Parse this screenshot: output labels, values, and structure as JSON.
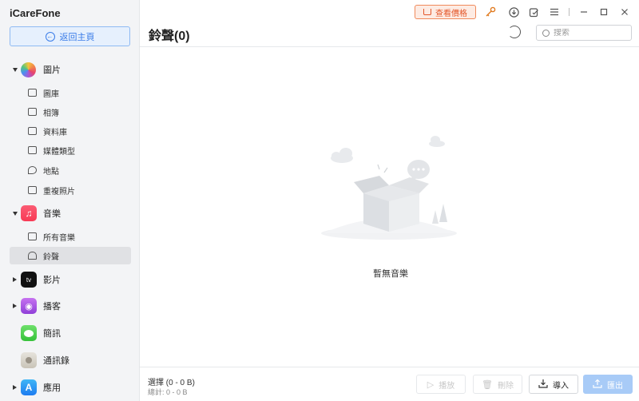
{
  "app": {
    "title": "iCareFone"
  },
  "sidebar": {
    "back_label": "返回主頁",
    "categories": [
      {
        "label": "圖片",
        "expanded": true,
        "icon": "photos-icon"
      },
      {
        "label": "音樂",
        "expanded": true,
        "icon": "music-icon"
      },
      {
        "label": "影片",
        "expanded": false,
        "icon": "tv-icon"
      },
      {
        "label": "播客",
        "expanded": false,
        "icon": "podcast-icon"
      },
      {
        "label": "簡訊",
        "expanded": false,
        "icon": "messages-icon"
      },
      {
        "label": "通訊錄",
        "expanded": false,
        "icon": "contacts-icon"
      },
      {
        "label": "應用",
        "expanded": false,
        "icon": "appstore-icon"
      }
    ],
    "photo_items": [
      "圖庫",
      "相簿",
      "資料庫",
      "媒體類型",
      "地點",
      "重複照片"
    ],
    "music_items": [
      "所有音樂",
      "鈴聲"
    ],
    "active_item": "鈴聲"
  },
  "topbar": {
    "price_label": "查看價格",
    "icons": [
      "key-icon",
      "download-icon",
      "feedback-icon",
      "menu-icon",
      "minimize-icon",
      "maximize-icon",
      "close-icon"
    ]
  },
  "main": {
    "title": "鈴聲(0)",
    "search_placeholder": "搜索",
    "empty_text": "暫無音樂"
  },
  "bottom": {
    "selection": "選擇 (0 - 0 B)",
    "total": "總計: 0 - 0 B",
    "buttons": {
      "play": "播放",
      "delete": "刪除",
      "import": "導入",
      "export": "匯出"
    }
  },
  "colors": {
    "accent": "#3a7ce8",
    "price": "#e4572a",
    "export_bg": "#a8cbf7"
  }
}
